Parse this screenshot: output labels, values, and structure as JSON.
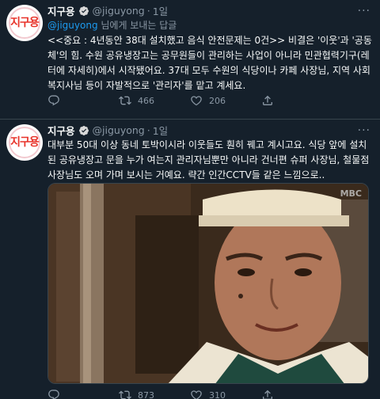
{
  "tweet1": {
    "avatar_text": "지구용",
    "name": "지구용",
    "handle": "@jiguyong",
    "separator": "·",
    "time": "1일",
    "reply_mention": "@jiguyong",
    "reply_suffix": " 님에게 보내는 답글",
    "text": "<<중요 : 4년동안 38대 설치했고 음식 안전문제는 0건>> 비결은 '이웃'과 '공동체'의 힘. 수원 공유냉장고는 공무원들이 관리하는 사업이 아니라 민관협력기구(레터에 자세히)에서 시작됐어요. 37대 모두 수원의 식당이나 카페 사장님, 지역 사회복지사님 등이 자발적으로 '관리자'를 맡고 계세요.",
    "retweets": "466",
    "likes": "206"
  },
  "tweet2": {
    "avatar_text": "지구용",
    "name": "지구용",
    "handle": "@jiguyong",
    "separator": "·",
    "time": "1일",
    "text": "대부분 50대 이상 동네 토박이시라 이웃들도 훤히 꿰고 계시고요. 식당 앞에 설치된 공유냉장고 문을 누가 여는지 관리자님뿐만 아니라 건너편 슈퍼 사장님, 철물점 사장님도 오며 가며 보시는 거예요. 략간 인간CCTV들 같은 느낌으로..",
    "media_watermark": "MBC",
    "retweets": "873",
    "likes": "310"
  },
  "colors": {
    "background": "#15202b",
    "text": "#f7f9f9",
    "secondary": "#8b98a5",
    "accent": "#1d9bf0",
    "divider": "#38444d"
  }
}
